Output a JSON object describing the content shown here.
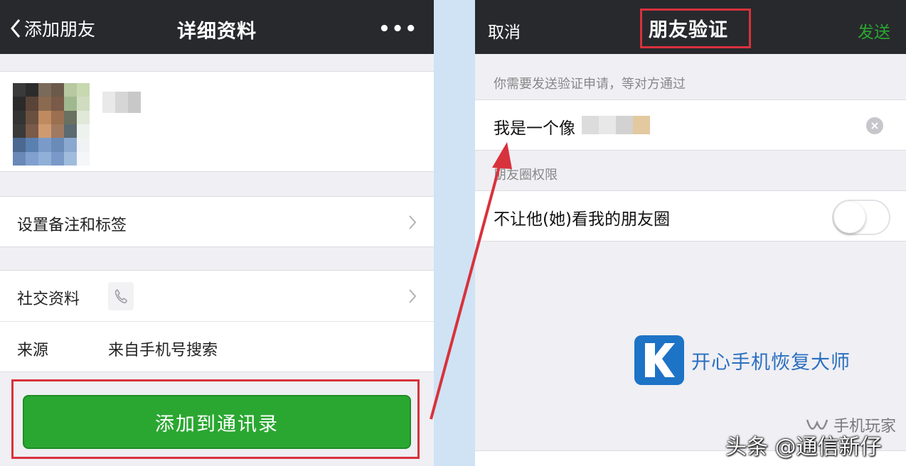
{
  "left": {
    "navbar": {
      "back_label": "添加朋友",
      "title": "详细资料",
      "more": "•••"
    },
    "rows": {
      "remark_label": "设置备注和标签",
      "social_label": "社交资料",
      "source_label": "来源",
      "source_value": "来自手机号搜索"
    },
    "add_button": "添加到通讯录"
  },
  "right": {
    "navbar": {
      "cancel": "取消",
      "title": "朋友验证",
      "send": "发送"
    },
    "hint": "你需要发送验证申请，等对方通过",
    "verify_text": "我是一个像",
    "moments_header": "朋友圈权限",
    "moments_row_label": "不让他(她)看我的朋友圈",
    "moments_toggle_on": false
  },
  "watermark": {
    "text": "开心手机恢复大师"
  },
  "brand": {
    "text": "手机玩家"
  },
  "credit": {
    "text": "头条 @通信新仔"
  },
  "colors": {
    "navbar": "#28292d",
    "wechat_green": "#2aa731",
    "highlight_red": "#d8323c",
    "watermark_blue": "#1d73c6"
  }
}
